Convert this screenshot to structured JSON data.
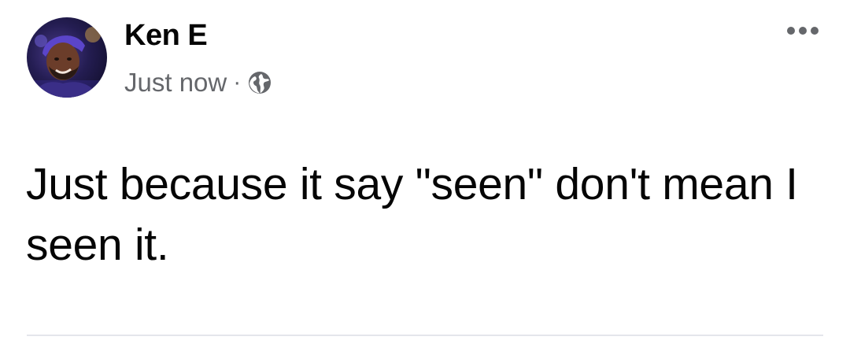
{
  "post": {
    "author": "Ken E",
    "timestamp": "Just now",
    "separator": "·",
    "privacy_icon": "globe-icon",
    "more_icon": "more-options-icon",
    "avatar_icon": "profile-photo",
    "text": "Just because it say \"seen\" don't mean I seen it."
  },
  "colors": {
    "text": "#050505",
    "meta": "#65676b",
    "divider": "#e4e6eb",
    "background": "#ffffff"
  }
}
